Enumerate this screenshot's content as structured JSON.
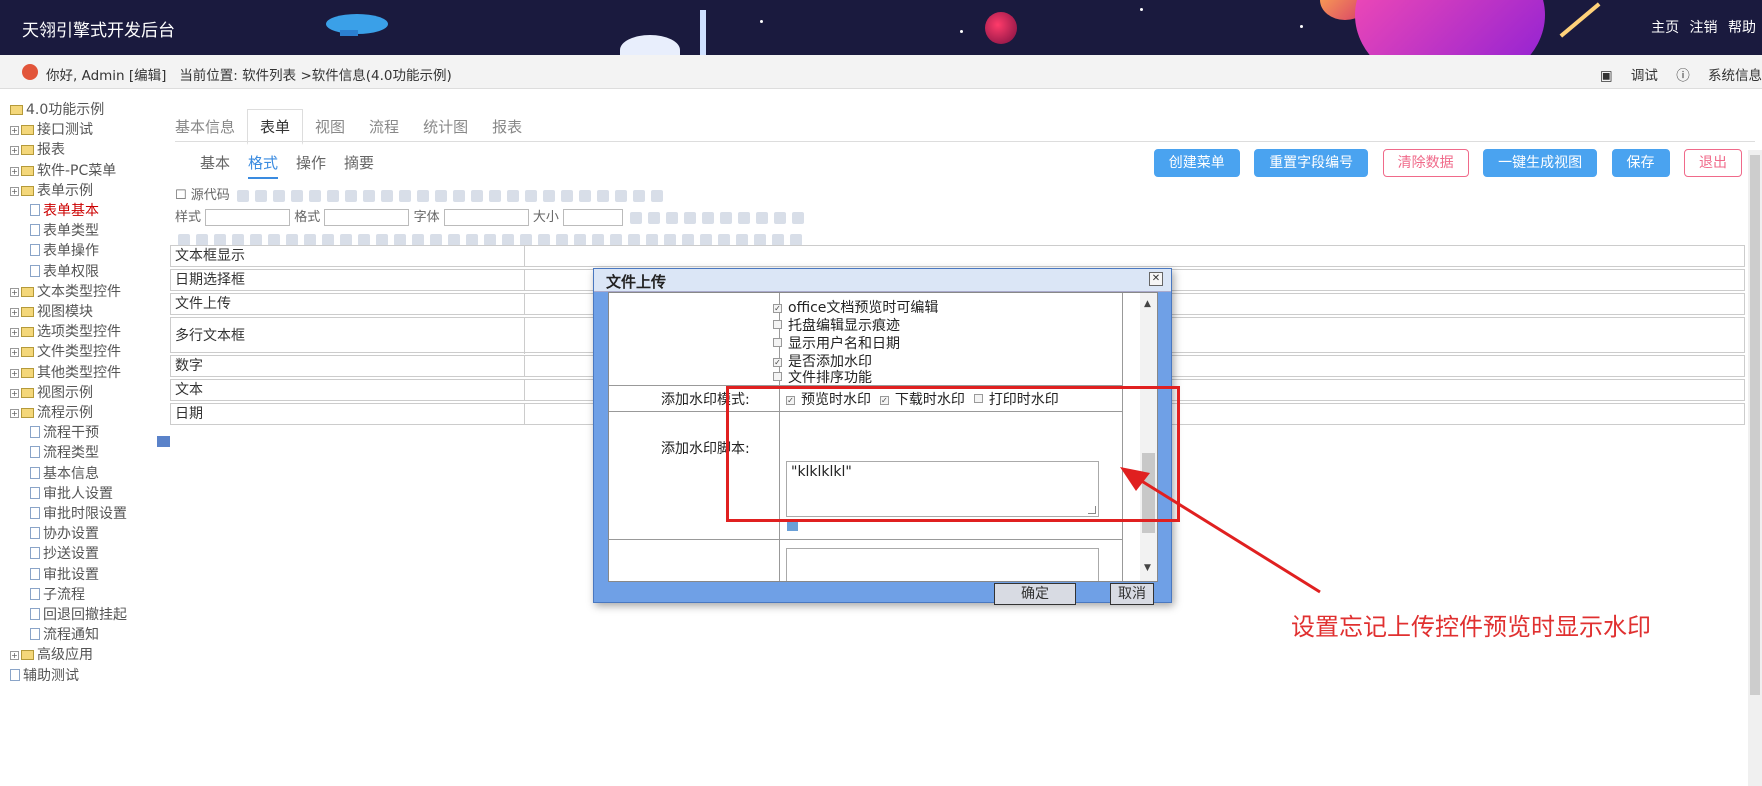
{
  "app": {
    "title": "天翎引擎式开发后台",
    "top_links": [
      "主页",
      "注销",
      "帮助"
    ]
  },
  "breadcrumb": {
    "greeting": "你好, Admin [编辑]",
    "location": "当前位置: 软件列表 >软件信息(4.0功能示例)",
    "debug": "调试",
    "sysinfo": "系统信息"
  },
  "tree": {
    "items": [
      {
        "label": "4.0功能示例",
        "level": 0,
        "type": "root"
      },
      {
        "label": "接口测试",
        "level": 1,
        "type": "folder"
      },
      {
        "label": "报表",
        "level": 1,
        "type": "folder"
      },
      {
        "label": "软件-PC菜单",
        "level": 1,
        "type": "folder"
      },
      {
        "label": "表单示例",
        "level": 1,
        "type": "folder"
      },
      {
        "label": "表单基本",
        "level": 2,
        "type": "leaf",
        "selected": true
      },
      {
        "label": "表单类型",
        "level": 2,
        "type": "leaf"
      },
      {
        "label": "表单操作",
        "level": 2,
        "type": "leaf"
      },
      {
        "label": "表单权限",
        "level": 2,
        "type": "leaf"
      },
      {
        "label": "文本类型控件",
        "level": 1,
        "type": "folder"
      },
      {
        "label": "视图模块",
        "level": 1,
        "type": "folder"
      },
      {
        "label": "选项类型控件",
        "level": 1,
        "type": "folder"
      },
      {
        "label": "文件类型控件",
        "level": 1,
        "type": "folder"
      },
      {
        "label": "其他类型控件",
        "level": 1,
        "type": "folder"
      },
      {
        "label": "视图示例",
        "level": 1,
        "type": "folder"
      },
      {
        "label": "流程示例",
        "level": 1,
        "type": "folder"
      },
      {
        "label": "流程干预",
        "level": 2,
        "type": "leaf"
      },
      {
        "label": "流程类型",
        "level": 2,
        "type": "leaf"
      },
      {
        "label": "基本信息",
        "level": 2,
        "type": "leaf"
      },
      {
        "label": "审批人设置",
        "level": 2,
        "type": "leaf"
      },
      {
        "label": "审批时限设置",
        "level": 2,
        "type": "leaf"
      },
      {
        "label": "协办设置",
        "level": 2,
        "type": "leaf"
      },
      {
        "label": "抄送设置",
        "level": 2,
        "type": "leaf"
      },
      {
        "label": "审批设置",
        "level": 2,
        "type": "leaf"
      },
      {
        "label": "子流程",
        "level": 2,
        "type": "leaf"
      },
      {
        "label": "回退回撤挂起",
        "level": 2,
        "type": "leaf"
      },
      {
        "label": "流程通知",
        "level": 2,
        "type": "leaf"
      },
      {
        "label": "高级应用",
        "level": 1,
        "type": "folder"
      },
      {
        "label": "辅助测试",
        "level": 1,
        "type": "leaf"
      }
    ]
  },
  "tabs_main": [
    "基本信息",
    "表单",
    "视图",
    "流程",
    "统计图",
    "报表"
  ],
  "tabs_main_active": "表单",
  "tabs_sub": [
    "基本",
    "格式",
    "操作",
    "摘要"
  ],
  "tabs_sub_active": "格式",
  "buttons": {
    "create_menu": "创建菜单",
    "reset_field_no": "重置字段编号",
    "clear_data": "清除数据",
    "gen_view": "一键生成视图",
    "save": "保存",
    "exit": "退出"
  },
  "toolbar": {
    "source": "源代码",
    "style": "样式",
    "format": "格式",
    "font": "字体",
    "size": "大小"
  },
  "form_rows": [
    "文本框显示",
    "日期选择框",
    "文件上传",
    "多行文本框",
    "数字",
    "文本",
    "日期"
  ],
  "dialog": {
    "title": "文件上传",
    "options": [
      {
        "label": "office文档预览时可编辑",
        "checked": true
      },
      {
        "label": "托盘编辑显示痕迹",
        "checked": false
      },
      {
        "label": "显示用户名和日期",
        "checked": false
      },
      {
        "label": "是否添加水印",
        "checked": true
      },
      {
        "label": "文件排序功能",
        "checked": false
      }
    ],
    "watermark_mode_label": "添加水印模式:",
    "watermark_modes": [
      {
        "label": "预览时水印",
        "checked": true
      },
      {
        "label": "下载时水印",
        "checked": true
      },
      {
        "label": "打印时水印",
        "checked": false
      }
    ],
    "script_label": "添加水印脚本:",
    "script_value": "\"klklklkl\"",
    "ok": "确定",
    "cancel": "取消"
  },
  "annotation": "设置忘记上传控件预览时显示水印",
  "colors": {
    "topbar": "#1a1a3e",
    "accent": "#4aa3f0",
    "annotation": "#e02020"
  }
}
